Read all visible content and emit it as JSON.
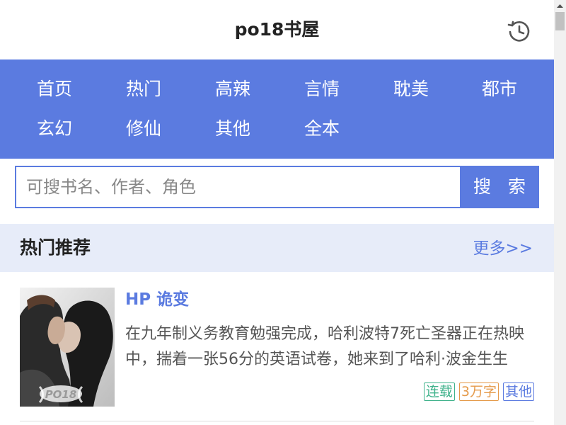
{
  "header": {
    "title": "po18书屋",
    "history_icon": "history-clock-icon"
  },
  "nav": {
    "items": [
      {
        "label": "首页"
      },
      {
        "label": "热门"
      },
      {
        "label": "高辣"
      },
      {
        "label": "言情"
      },
      {
        "label": "耽美"
      },
      {
        "label": "都市"
      },
      {
        "label": "玄幻"
      },
      {
        "label": "修仙"
      },
      {
        "label": "其他"
      },
      {
        "label": "全本"
      }
    ]
  },
  "search": {
    "placeholder": "可搜书名、作者、角色",
    "value": "",
    "button_label": "搜 索"
  },
  "section": {
    "title": "热门推荐",
    "more_label": "更多>>"
  },
  "books": [
    {
      "title": "HP 诡变",
      "description": "在九年制义务教育勉强完成，哈利波特7死亡圣器正在热映中，揣着一张56分的英语试卷，她来到了哈利·波金生生",
      "cover_watermark": "PO18",
      "tags": [
        {
          "label": "连载",
          "color": "#3fb28b"
        },
        {
          "label": "3万字",
          "color": "#e59a4a"
        },
        {
          "label": "其他",
          "color": "#5b7be0"
        }
      ]
    }
  ],
  "colors": {
    "accent": "#5b7be0",
    "section_bg": "#e7ecf9"
  }
}
